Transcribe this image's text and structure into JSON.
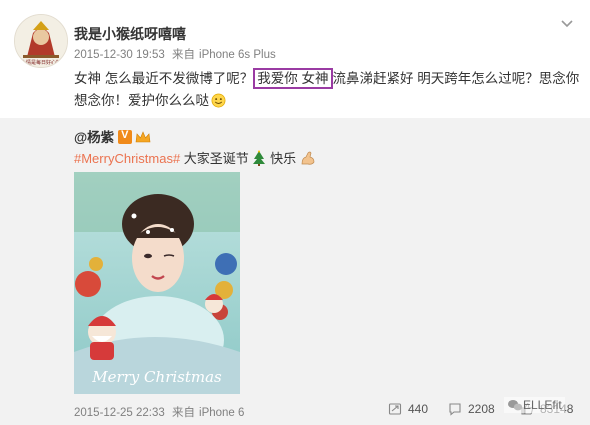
{
  "post": {
    "author": "我是小猴纸呀嘻嘻",
    "date": "2015-12-30 19:53",
    "source_prefix": "来自",
    "device": "iPhone 6s Plus",
    "text_part1": "女神 怎么最近不发微博了呢？",
    "text_highlight": "我爱你 女神",
    "text_part2": "流鼻涕赶紧好 明天跨年怎么过呢？思念你想念你！爱护你么么哒",
    "avatar_caption": "心情是每日好心好"
  },
  "repost": {
    "author": "@杨紫",
    "topic": "#MerryChristmas#",
    "text_a": " 大家圣诞节",
    "text_b": "快乐",
    "photo_caption": "Merry Christmas",
    "date": "2015-12-25 22:33",
    "source_prefix": "来自",
    "device": "iPhone 6",
    "reposts": "440",
    "comments": "2208",
    "likes": "83148"
  },
  "watermark": "ELLEfit",
  "icons": {
    "chevron": "chevron-down-icon",
    "vip": "vip-badge-icon",
    "crown": "crown-icon",
    "repost": "repost-icon",
    "comment": "comment-icon",
    "like": "like-icon"
  },
  "colors": {
    "highlight_border": "#9a3ba3",
    "topic": "#eb7350",
    "repost_bg": "#f2f2f2"
  }
}
